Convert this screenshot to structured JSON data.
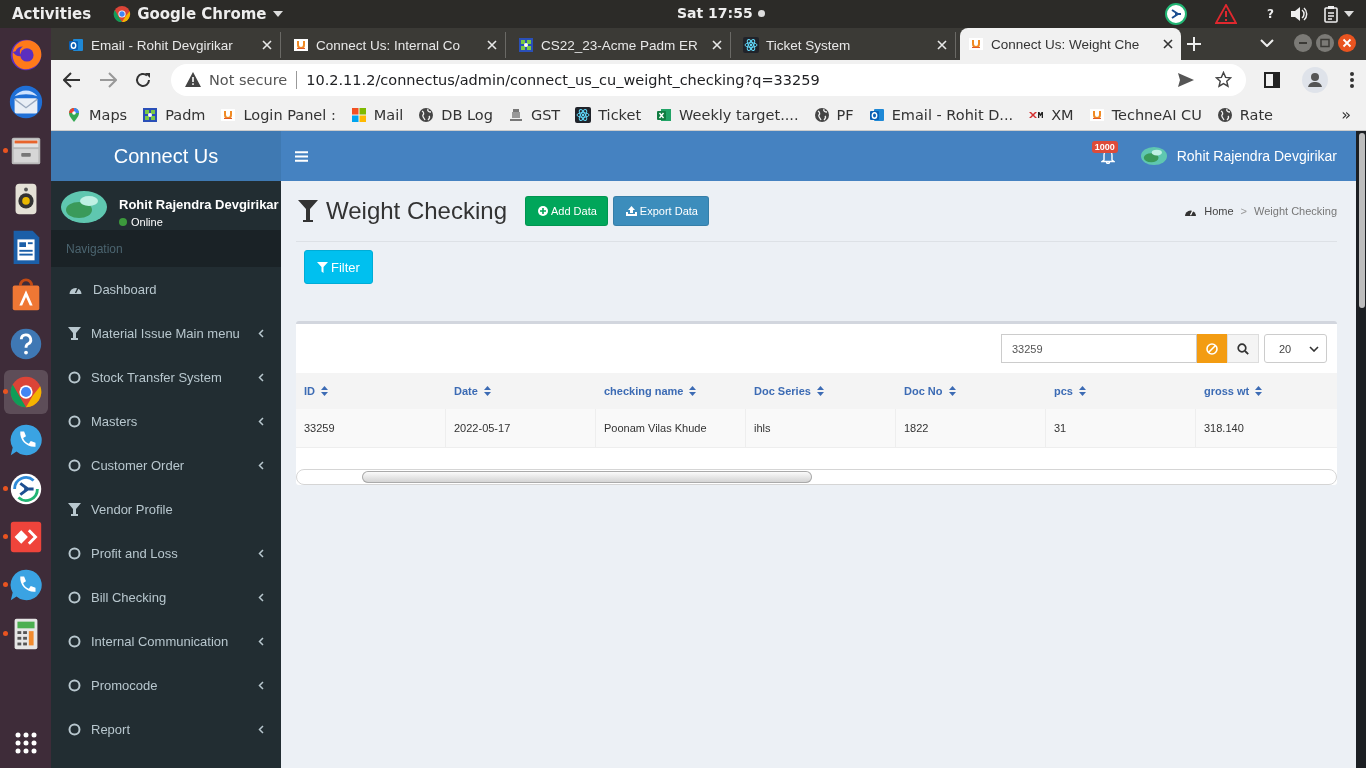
{
  "top_bar": {
    "activities": "Activities",
    "app_name": "Google Chrome",
    "clock": "Sat 17:55",
    "help": "?"
  },
  "dock": [
    {
      "kind": "firefox",
      "running": false,
      "selected": false
    },
    {
      "kind": "thunderbird",
      "running": false,
      "selected": false
    },
    {
      "kind": "files",
      "running": true,
      "selected": false
    },
    {
      "kind": "rhythmbox",
      "running": false,
      "selected": false
    },
    {
      "kind": "writer",
      "running": false,
      "selected": false
    },
    {
      "kind": "software",
      "running": false,
      "selected": false
    },
    {
      "kind": "help",
      "running": false,
      "selected": false
    },
    {
      "kind": "chrome",
      "running": true,
      "selected": true
    },
    {
      "kind": "phone",
      "running": false,
      "selected": false
    },
    {
      "kind": "remote",
      "running": true,
      "selected": false
    },
    {
      "kind": "anydesk",
      "running": true,
      "selected": false
    },
    {
      "kind": "phone",
      "running": true,
      "selected": false
    },
    {
      "kind": "calculator",
      "running": true,
      "selected": false
    }
  ],
  "browser": {
    "tabs": [
      {
        "title": "Email - Rohit Devgirikar",
        "kind": "outlook",
        "selected": false
      },
      {
        "title": "Connect Us: Internal Co",
        "kind": "cu",
        "selected": false
      },
      {
        "title": "CS22_23-Acme Padm ER",
        "kind": "padm",
        "selected": false
      },
      {
        "title": "Ticket System",
        "kind": "react",
        "selected": false
      },
      {
        "title": "Connect Us: Weight Che",
        "kind": "cu",
        "selected": true
      }
    ],
    "address": {
      "security": "Not secure",
      "url": "10.2.11.2/connectus/admin/connect_us_cu_weight_checking?q=33259"
    },
    "bookmarks": [
      {
        "label": "Maps",
        "kind": "maps"
      },
      {
        "label": "Padm",
        "kind": "padm"
      },
      {
        "label": "Login Panel :",
        "kind": "cu"
      },
      {
        "label": "Mail",
        "kind": "windows"
      },
      {
        "label": "DB Log",
        "kind": "globe"
      },
      {
        "label": "GST",
        "kind": "emblem"
      },
      {
        "label": "Ticket",
        "kind": "react"
      },
      {
        "label": "Weekly target....",
        "kind": "excel"
      },
      {
        "label": "PF",
        "kind": "globe"
      },
      {
        "label": "Email - Rohit D...",
        "kind": "outlook"
      },
      {
        "label": "XM",
        "kind": "xm"
      },
      {
        "label": "TechneAI CU",
        "kind": "cu"
      },
      {
        "label": "Rate",
        "kind": "globe"
      }
    ],
    "bookmarks_more": "»"
  },
  "app": {
    "brand": "Connect Us",
    "user": {
      "name": "Rohit Rajendra Devgirikar",
      "status": "Online"
    },
    "nav_header": "Navigation",
    "menu": [
      {
        "label": "Dashboard",
        "kind": "dashboard",
        "has_submenu": false
      },
      {
        "label": "Material Issue Main menu",
        "kind": "filter",
        "has_submenu": true
      },
      {
        "label": "Stock Transfer System",
        "kind": "circle",
        "has_submenu": true
      },
      {
        "label": "Masters",
        "kind": "circle",
        "has_submenu": true
      },
      {
        "label": "Customer Order",
        "kind": "circle",
        "has_submenu": true
      },
      {
        "label": "Vendor Profile",
        "kind": "filter",
        "has_submenu": false
      },
      {
        "label": "Profit and Loss",
        "kind": "circle",
        "has_submenu": true
      },
      {
        "label": "Bill Checking",
        "kind": "circle",
        "has_submenu": true
      },
      {
        "label": "Internal Communication",
        "kind": "circle",
        "has_submenu": true
      },
      {
        "label": "Promocode",
        "kind": "circle",
        "has_submenu": true
      },
      {
        "label": "Report",
        "kind": "circle",
        "has_submenu": true
      }
    ],
    "header": {
      "notifications": "1000",
      "user_name": "Rohit Rajendra Devgirikar"
    },
    "page": {
      "title": "Weight Checking",
      "buttons": [
        {
          "label": "Add Data",
          "kind": "add"
        },
        {
          "label": "Export Data",
          "kind": "export"
        }
      ],
      "breadcrumb": [
        "Home",
        "Weight Checking"
      ],
      "breadcrumb_separator": ">",
      "filter": "Filter"
    },
    "table": {
      "search": "33259",
      "page_size": "20",
      "columns": [
        "ID",
        "Date",
        "checking name",
        "Doc Series",
        "Doc No",
        "pcs",
        "gross wt"
      ],
      "rows": [
        [
          "33259",
          "2022-05-17",
          "Poonam Vilas Khude",
          "ihls",
          "1822",
          "31",
          "318.140"
        ]
      ]
    }
  }
}
